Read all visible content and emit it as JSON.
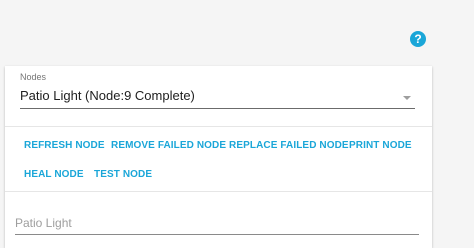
{
  "help": {
    "icon": "help-circle-icon",
    "glyph": "?"
  },
  "nodes_select": {
    "label": "Nodes",
    "value": "Patio Light (Node:9 Complete)",
    "icon": "chevron-down-icon"
  },
  "actions": {
    "refresh": "REFRESH NODE",
    "remove_failed": "REMOVE FAILED NODE",
    "replace_failed": "REPLACE FAILED NODE",
    "print": "PRINT NODE",
    "heal": "HEAL NODE",
    "test": "TEST NODE"
  },
  "node_name_field": {
    "placeholder": "Patio Light"
  },
  "colors": {
    "accent": "#1aa6d8",
    "background": "#f5f5f5",
    "card": "#ffffff",
    "text": "#212121",
    "label": "#757575"
  }
}
